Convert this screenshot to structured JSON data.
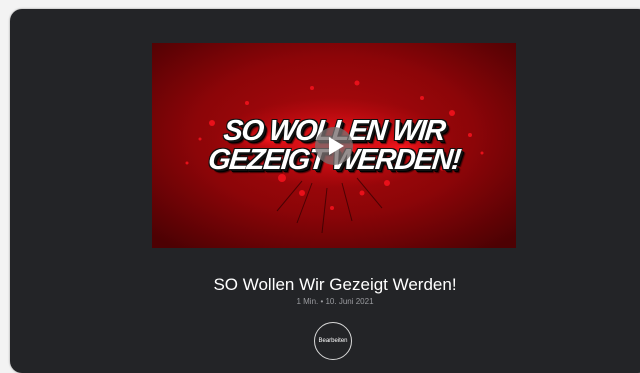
{
  "video": {
    "thumbnail_text_line1": "SO WOLLEN WIR",
    "thumbnail_text_line2": "GEZEIGT WERDEN!",
    "play_icon": "play-icon",
    "colors": {
      "background_dark": "#5a0204",
      "background_mid": "#a1080c",
      "splatter": "#e0101a"
    }
  },
  "post": {
    "title": "SO Wollen Wir Gezeigt Werden!",
    "meta": "1 Min. • 10. Juni 2021",
    "edit_label": "Bearbeiten"
  },
  "colors": {
    "card_bg": "#232427",
    "page_bg": "#f3f3f3",
    "title_text": "#ffffff",
    "meta_text": "#9a9b9f"
  }
}
